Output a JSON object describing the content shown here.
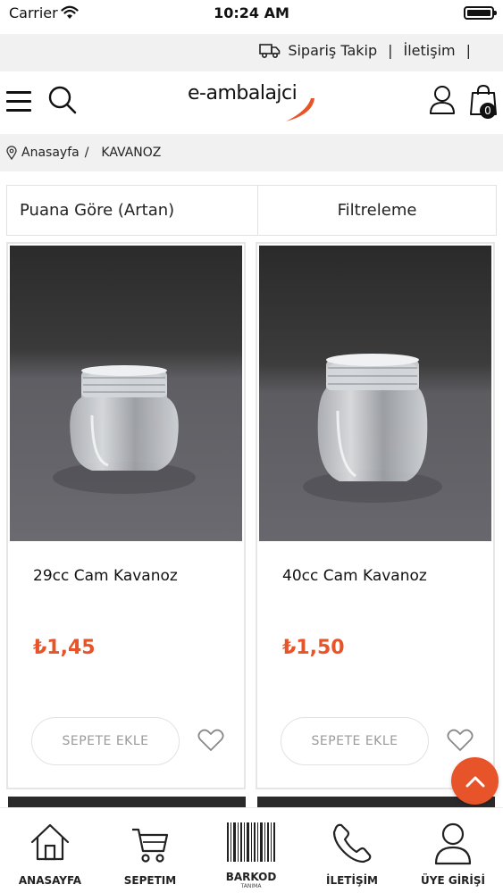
{
  "status": {
    "carrier": "Carrier",
    "time": "10:24 AM"
  },
  "topbar": {
    "order_tracking": "Sipariş Takip",
    "separator": "|",
    "contact": "İletişim"
  },
  "header": {
    "logo": "e-ambalajci",
    "cart_count": "0"
  },
  "breadcrumb": {
    "home": "Anasayfa",
    "separator": "/",
    "current": "KAVANOZ"
  },
  "sort": {
    "label": "Puana Göre (Artan)"
  },
  "filter": {
    "label": "Filtreleme"
  },
  "products": [
    {
      "title": "29cc Cam Kavanoz",
      "price": "₺1,45",
      "button": "SEPETE EKLE"
    },
    {
      "title": "40cc Cam Kavanoz",
      "price": "₺1,50",
      "button": "SEPETE EKLE"
    }
  ],
  "bottom_nav": [
    {
      "label": "ANASAYFA",
      "icon": "home-icon"
    },
    {
      "label": "SEPETIM",
      "icon": "cart-icon"
    },
    {
      "label": "BARKOD",
      "sublabel": "TANIMA",
      "icon": "barcode-icon"
    },
    {
      "label": "İLETİŞİM",
      "icon": "phone-icon"
    },
    {
      "label": "ÜYE GİRİŞİ",
      "icon": "user-icon"
    }
  ],
  "colors": {
    "accent": "#e8542a",
    "topbar_bg": "#f1f1f1",
    "text": "#222222"
  }
}
